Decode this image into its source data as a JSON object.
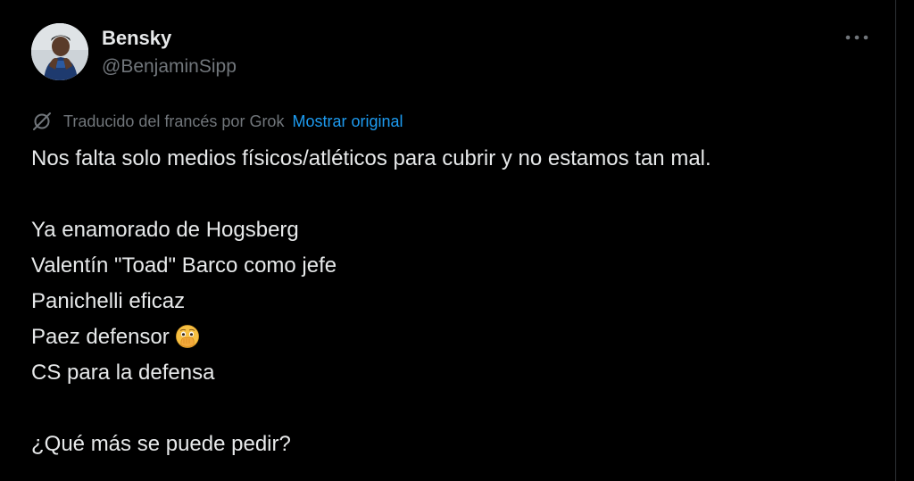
{
  "colors": {
    "background": "#000000",
    "text": "#e7e9ea",
    "secondary_text": "#71767b",
    "link": "#1d9bf0"
  },
  "author": {
    "display_name": "Bensky",
    "handle": "@BenjaminSipp",
    "avatar_icon": "user-avatar-photo"
  },
  "menu": {
    "more_icon": "more-dots-icon"
  },
  "translation": {
    "icon": "translate-slash-icon",
    "note": "Traducido del francés por Grok",
    "show_original": "Mostrar original"
  },
  "tweet": {
    "lines": [
      "Nos falta solo medios físicos/atléticos para cubrir y no estamos tan mal.",
      "",
      "Ya enamorado de Hogsberg",
      "Valentín \"Toad\" Barco como jefe",
      "Panichelli eficaz",
      "Paez defensor",
      "CS para la defensa",
      "",
      "¿Qué más se puede pedir?"
    ],
    "emoji": "face-with-hand-over-mouth-and-open-eyes"
  }
}
